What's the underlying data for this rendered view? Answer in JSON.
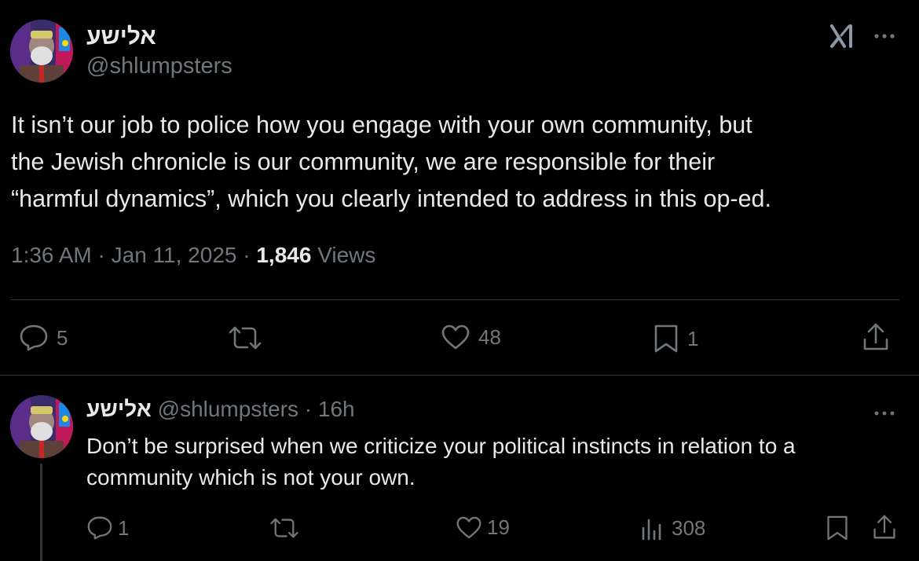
{
  "main_tweet": {
    "display_name": "אלישע",
    "handle": "@shlumpsters",
    "text": "It isn’t our job to police how you engage with your own community, but\nthe Jewish chronicle is our community, we are responsible for their\n“harmful dynamics”, which you clearly intended to address in this op-ed.",
    "time": "1:36 AM",
    "separator": "·",
    "date": "Jan 11, 2025",
    "views_count": "1,846",
    "views_label": "Views",
    "actions": {
      "replies": "5",
      "retweets": "",
      "likes": "48",
      "bookmarks": "1"
    }
  },
  "reply_tweet": {
    "display_name": "אלישע",
    "handle": "@shlumpsters",
    "separator": "·",
    "time_ago": "16h",
    "text": "Don’t be surprised when we criticize your political instincts in relation to a community which is not your own.",
    "actions": {
      "replies": "1",
      "retweets": "",
      "likes": "19",
      "views": "308"
    }
  },
  "icons": {
    "grok": "grok-icon",
    "more": "more-horizontal-icon",
    "reply": "reply-icon",
    "retweet": "retweet-icon",
    "like": "heart-icon",
    "bookmark": "bookmark-icon",
    "share": "share-icon",
    "views": "views-icon"
  },
  "colors": {
    "background": "#000000",
    "primary_text": "#e7e9ea",
    "secondary_text": "#71767b",
    "divider": "#2f3336"
  }
}
